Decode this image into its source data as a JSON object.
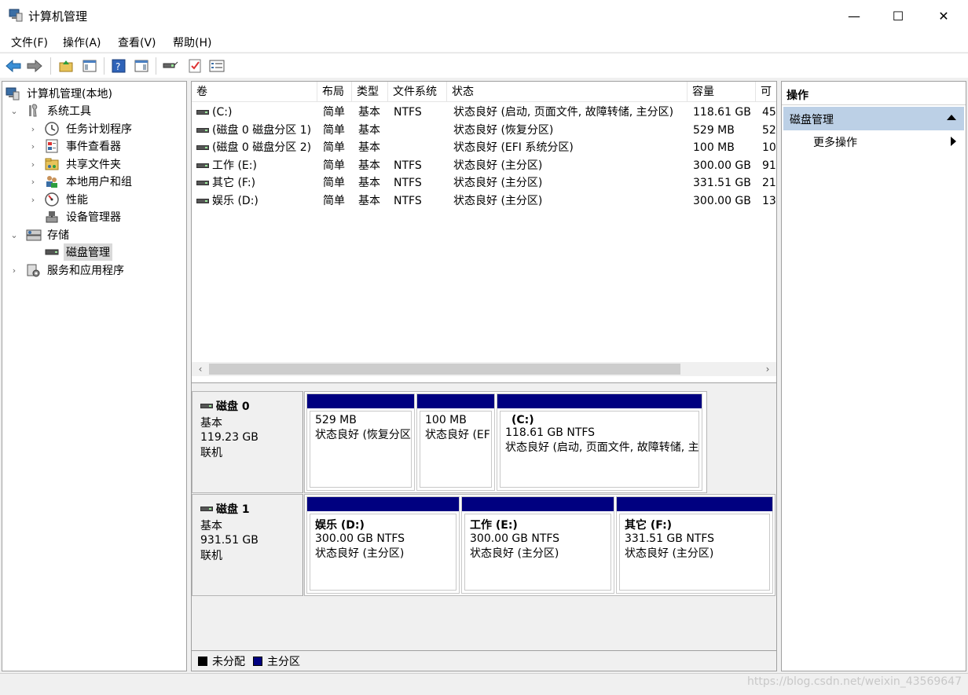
{
  "window": {
    "title": "计算机管理",
    "minimize": "—",
    "maximize": "☐",
    "close": "✕"
  },
  "menu": [
    "文件(F)",
    "操作(A)",
    "查看(V)",
    "帮助(H)"
  ],
  "tree": {
    "root": "计算机管理(本地)",
    "system_tools": "系统工具",
    "task_scheduler": "任务计划程序",
    "event_viewer": "事件查看器",
    "shared_folders": "共享文件夹",
    "local_users": "本地用户和组",
    "performance": "性能",
    "device_manager": "设备管理器",
    "storage": "存储",
    "disk_management": "磁盘管理",
    "services_apps": "服务和应用程序"
  },
  "volume_table": {
    "headers": [
      "卷",
      "布局",
      "类型",
      "文件系统",
      "状态",
      "容量",
      "可"
    ],
    "rows": [
      {
        "vol": "(C:)",
        "layout": "简单",
        "type": "基本",
        "fs": "NTFS",
        "status": "状态良好 (启动, 页面文件, 故障转储, 主分区)",
        "cap": "118.61 GB",
        "free": "45"
      },
      {
        "vol": "(磁盘 0 磁盘分区 1)",
        "layout": "简单",
        "type": "基本",
        "fs": "",
        "status": "状态良好 (恢复分区)",
        "cap": "529 MB",
        "free": "52"
      },
      {
        "vol": "(磁盘 0 磁盘分区 2)",
        "layout": "简单",
        "type": "基本",
        "fs": "",
        "status": "状态良好 (EFI 系统分区)",
        "cap": "100 MB",
        "free": "10"
      },
      {
        "vol": "工作 (E:)",
        "layout": "简单",
        "type": "基本",
        "fs": "NTFS",
        "status": "状态良好 (主分区)",
        "cap": "300.00 GB",
        "free": "91"
      },
      {
        "vol": "其它 (F:)",
        "layout": "简单",
        "type": "基本",
        "fs": "NTFS",
        "status": "状态良好 (主分区)",
        "cap": "331.51 GB",
        "free": "21"
      },
      {
        "vol": "娱乐 (D:)",
        "layout": "简单",
        "type": "基本",
        "fs": "NTFS",
        "status": "状态良好 (主分区)",
        "cap": "300.00 GB",
        "free": "13"
      }
    ]
  },
  "scroll": {
    "left": "‹",
    "right": "›"
  },
  "disks": [
    {
      "name": "磁盘 0",
      "kind": "基本",
      "size": "119.23 GB",
      "state": "联机",
      "partitions": [
        {
          "title": "",
          "line1": "529 MB",
          "line2": "状态良好 (恢复分区)"
        },
        {
          "title": "",
          "line1": "100 MB",
          "line2": "状态良好 (EFI 系统分区)"
        },
        {
          "title": "(C:)",
          "line1": "118.61 GB NTFS",
          "line2": "状态良好 (启动, 页面文件, 故障转储, 主分区)"
        }
      ]
    },
    {
      "name": "磁盘 1",
      "kind": "基本",
      "size": "931.51 GB",
      "state": "联机",
      "partitions": [
        {
          "title": "娱乐 (D:)",
          "line1": "300.00 GB NTFS",
          "line2": "状态良好 (主分区)"
        },
        {
          "title": "工作 (E:)",
          "line1": "300.00 GB NTFS",
          "line2": "状态良好 (主分区)"
        },
        {
          "title": "其它 (F:)",
          "line1": "331.51 GB NTFS",
          "line2": "状态良好 (主分区)"
        }
      ]
    }
  ],
  "legend": {
    "unallocated": "未分配",
    "primary": "主分区",
    "unallocated_color": "#000000",
    "primary_color": "#000080"
  },
  "actions": {
    "header": "操作",
    "section": "磁盘管理",
    "more": "更多操作"
  },
  "watermark": "https://blog.csdn.net/weixin_43569647",
  "colors": {
    "partition_bar": "#000080",
    "selected_section": "#bcd0e6"
  }
}
